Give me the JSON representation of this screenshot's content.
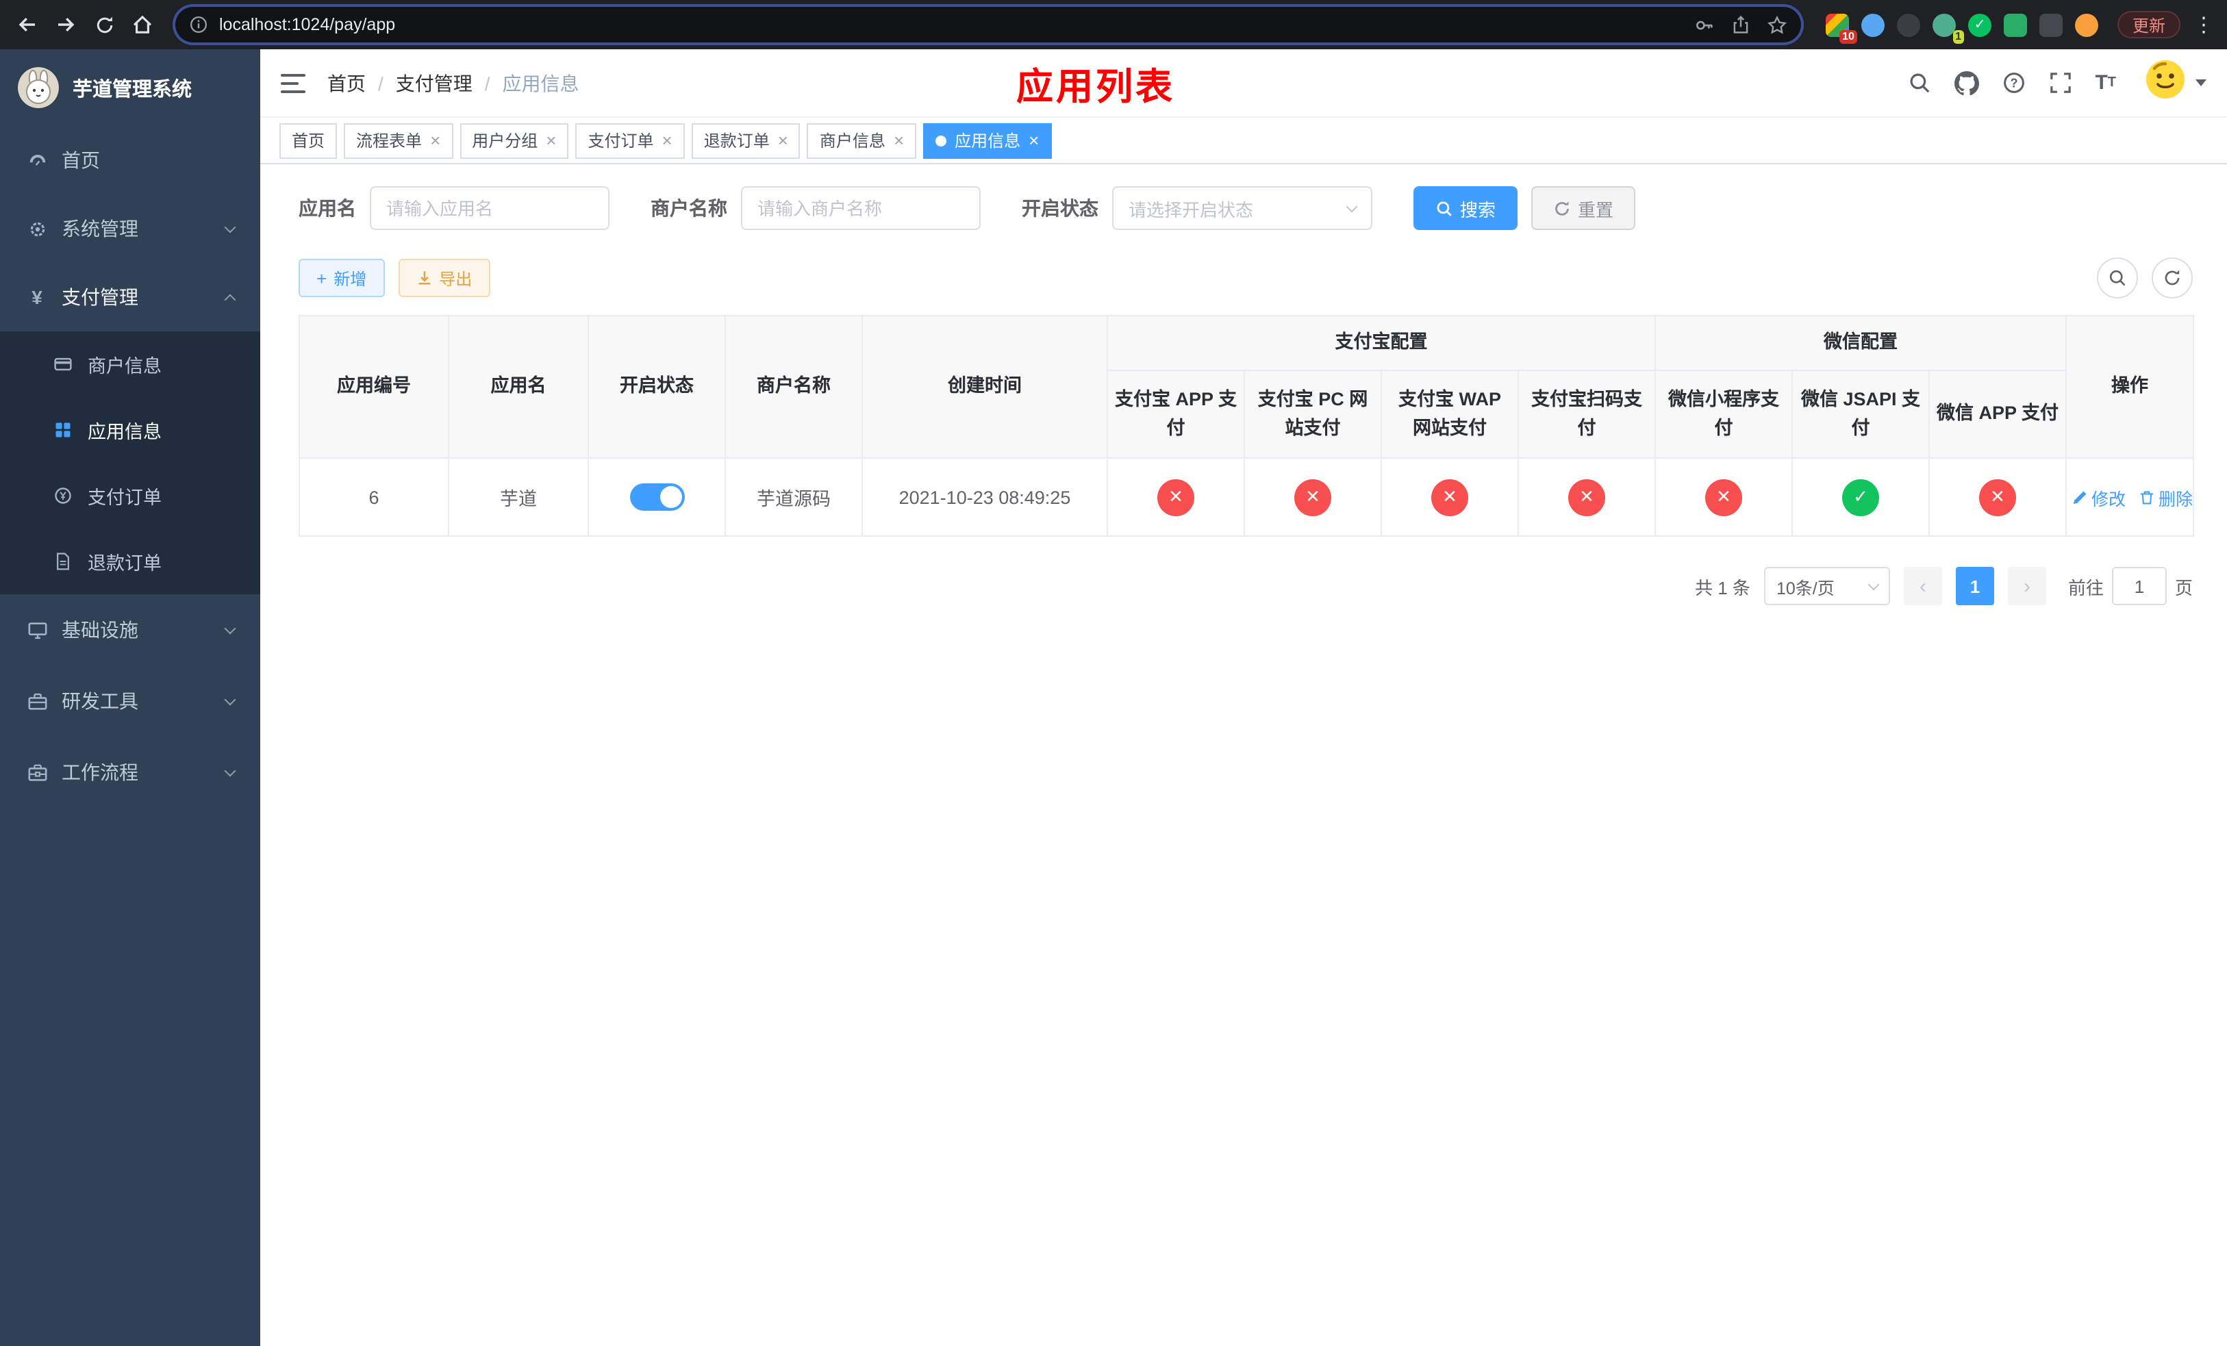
{
  "colors": {
    "accent": "#409eff",
    "danger": "#f85050",
    "success": "#12c35e",
    "warning": "#e6a23c",
    "title_red": "#fe0000"
  },
  "browser": {
    "url": "localhost:1024/pay/app",
    "update_button": "更新",
    "extension_badge_first": "10",
    "extension_badge_second": "1"
  },
  "sidebar": {
    "title": "芋道管理系统",
    "items": [
      {
        "label": "首页"
      },
      {
        "label": "系统管理"
      },
      {
        "label": "支付管理"
      },
      {
        "label": "基础设施"
      },
      {
        "label": "研发工具"
      },
      {
        "label": "工作流程"
      }
    ],
    "pay_children": [
      {
        "label": "商户信息"
      },
      {
        "label": "应用信息"
      },
      {
        "label": "支付订单"
      },
      {
        "label": "退款订单"
      }
    ]
  },
  "navbar": {
    "breadcrumb": [
      "首页",
      "支付管理",
      "应用信息"
    ],
    "page_title": "应用列表"
  },
  "tabs": [
    {
      "label": "首页"
    },
    {
      "label": "流程表单"
    },
    {
      "label": "用户分组"
    },
    {
      "label": "支付订单"
    },
    {
      "label": "退款订单"
    },
    {
      "label": "商户信息"
    },
    {
      "label": "应用信息"
    }
  ],
  "search": {
    "app_name_label": "应用名",
    "app_name_placeholder": "请输入应用名",
    "merchant_label": "商户名称",
    "merchant_placeholder": "请输入商户名称",
    "status_label": "开启状态",
    "status_placeholder": "请选择开启状态",
    "search_button": "搜索",
    "reset_button": "重置"
  },
  "toolbar": {
    "add_button": "新增",
    "export_button": "导出"
  },
  "table": {
    "columns": {
      "id": "应用编号",
      "name": "应用名",
      "status": "开启状态",
      "merchant": "商户名称",
      "created": "创建时间",
      "alipay_group": "支付宝配置",
      "wechat_group": "微信配置",
      "alipay": [
        "支付宝 APP 支付",
        "支付宝 PC 网站支付",
        "支付宝 WAP 网站支付",
        "支付宝扫码支付"
      ],
      "wechat": [
        "微信小程序支付",
        "微信 JSAPI 支付",
        "微信 APP 支付"
      ],
      "actions": "操作"
    },
    "rows": [
      {
        "id": "6",
        "name": "芋道",
        "enabled": true,
        "merchant": "芋道源码",
        "created": "2021-10-23 08:49:25",
        "configs": [
          false,
          false,
          false,
          false,
          false,
          true,
          false
        ],
        "edit": "修改",
        "delete": "删除"
      }
    ]
  },
  "pagination": {
    "total": "共 1 条",
    "page_size": "10条/页",
    "page": "1",
    "goto_label": "前往",
    "goto_value": "1",
    "goto_unit": "页"
  }
}
